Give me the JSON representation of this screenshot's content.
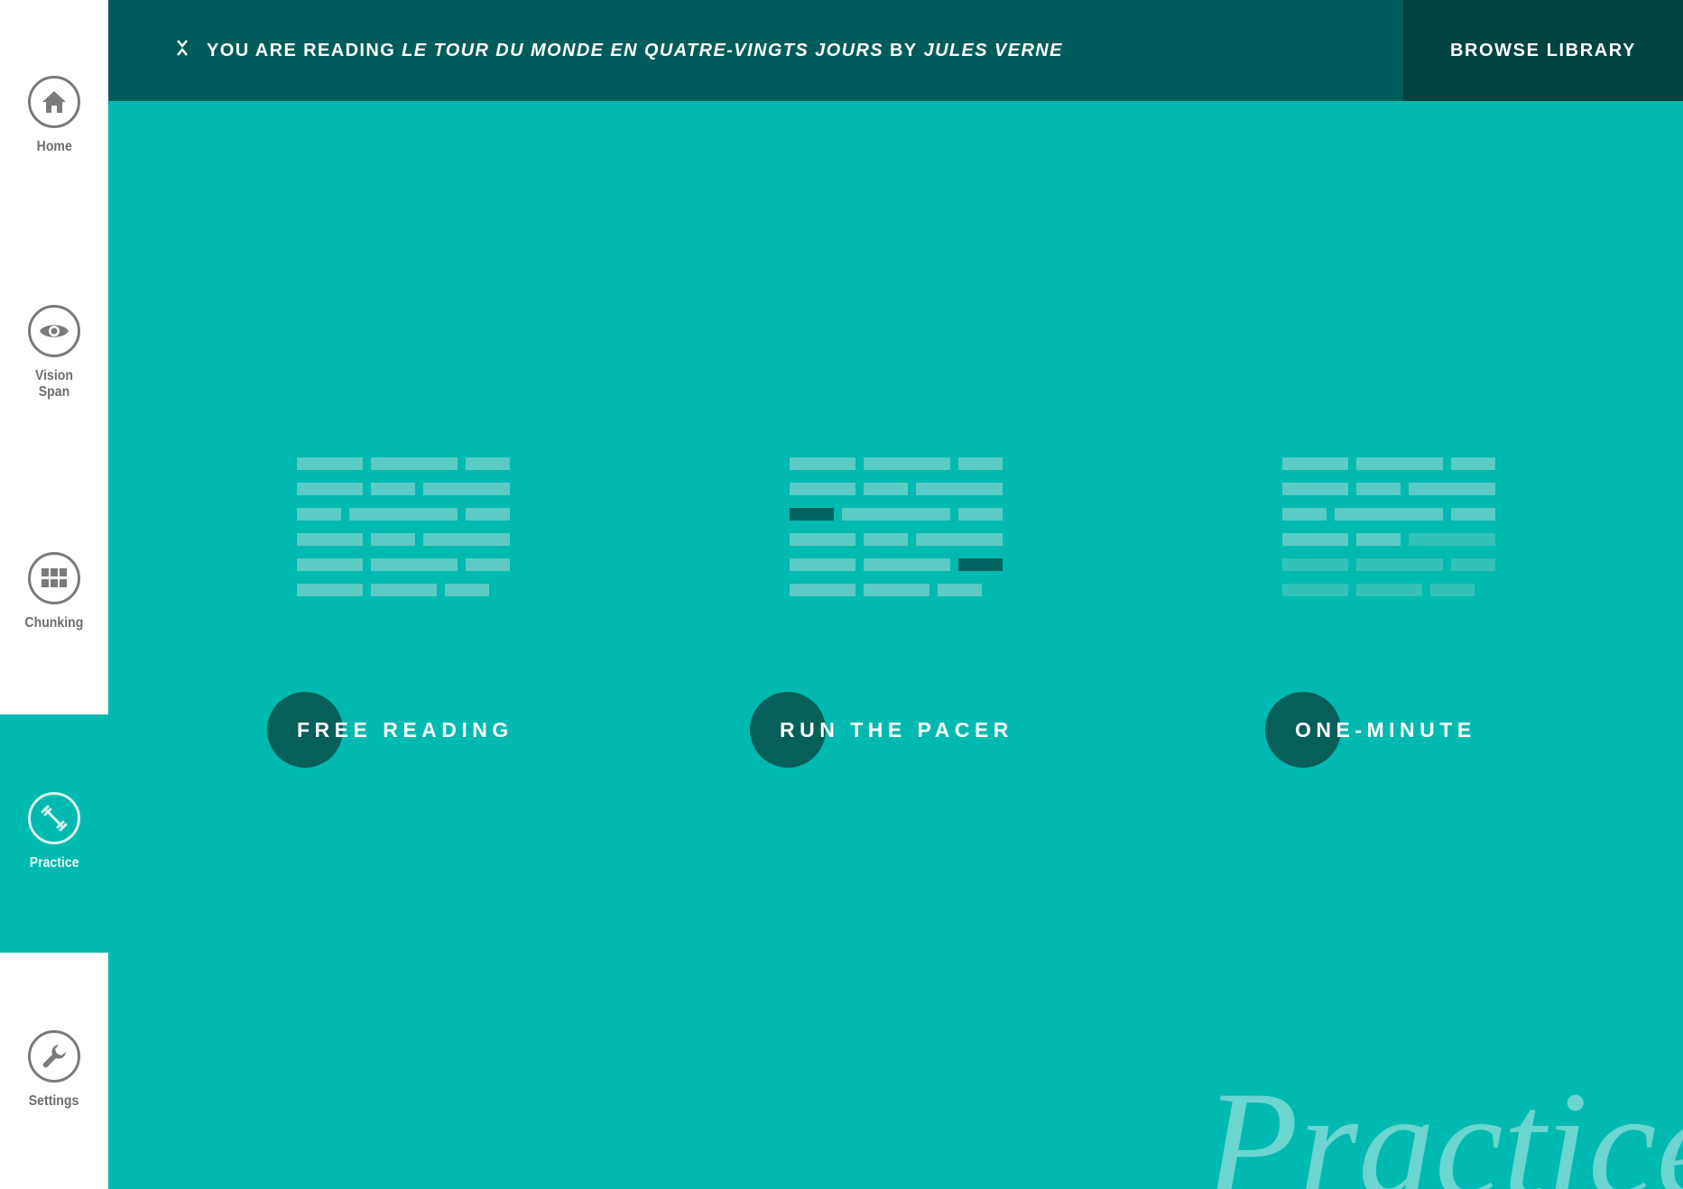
{
  "sidebar": {
    "items": [
      {
        "label": "Home",
        "icon": "home-icon",
        "active": false
      },
      {
        "label": "Vision Span",
        "icon": "eye-icon",
        "active": false
      },
      {
        "label": "Chunking",
        "icon": "grid-icon",
        "active": false
      },
      {
        "label": "Practice",
        "icon": "dumbbell-icon",
        "active": true
      },
      {
        "label": "Settings",
        "icon": "wrench-icon",
        "active": false
      }
    ]
  },
  "topbar": {
    "prefix": "YOU ARE READING",
    "book_title": "LE TOUR DU MONDE EN QUATRE-VINGTS JOURS",
    "by": "BY",
    "author": "JULES VERNE",
    "browse_label": "BROWSE LIBRARY"
  },
  "modes": [
    {
      "label": "FREE READING",
      "icon": "text-lines-icon"
    },
    {
      "label": "RUN THE PACER",
      "icon": "pacer-lines-icon"
    },
    {
      "label": "ONE-MINUTE",
      "icon": "fading-lines-icon"
    }
  ],
  "page_heading": "Practice",
  "colors": {
    "background": "#00b9b0",
    "topbar": "#005c5a",
    "browse_button": "#004442",
    "mode_circle": "#075f5a",
    "sidebar": "#ffffff"
  }
}
